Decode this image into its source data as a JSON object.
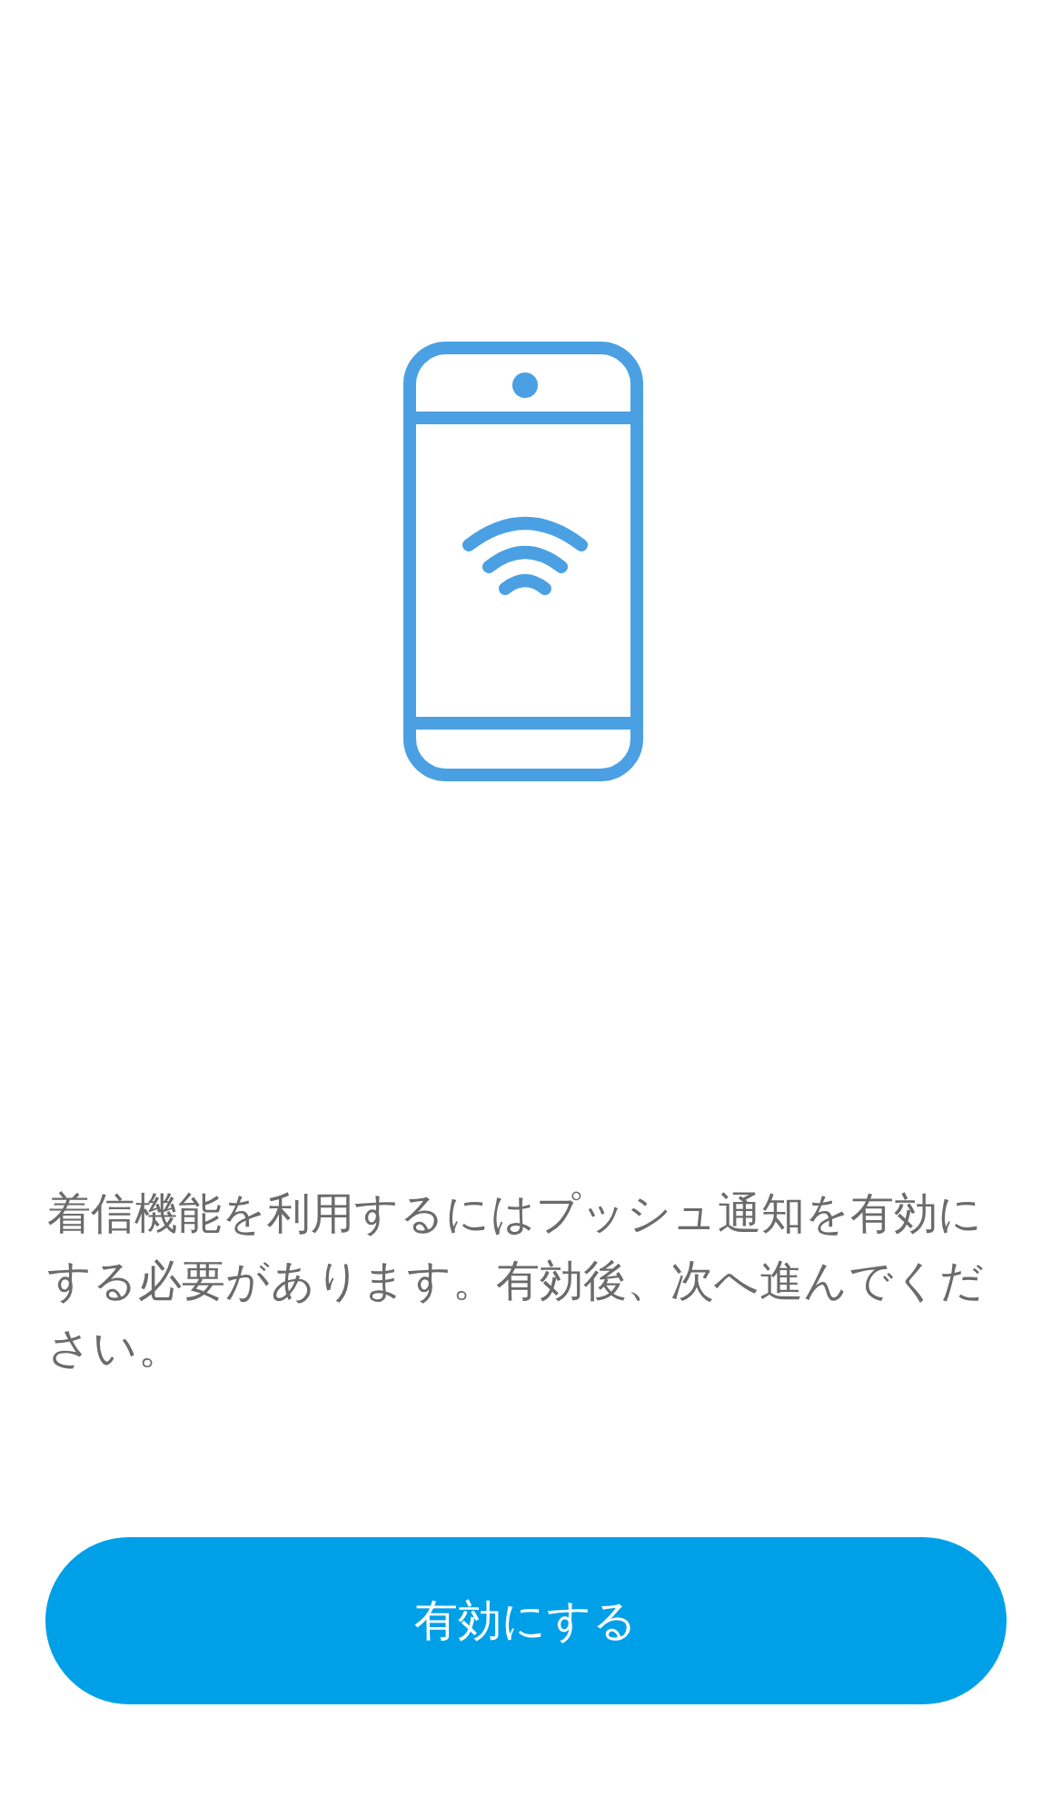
{
  "message": "着信機能を利用するにはプッシュ通知を有効にする必要があります。有効後、次へ進んでください。",
  "button": {
    "label": "有効にする"
  }
}
